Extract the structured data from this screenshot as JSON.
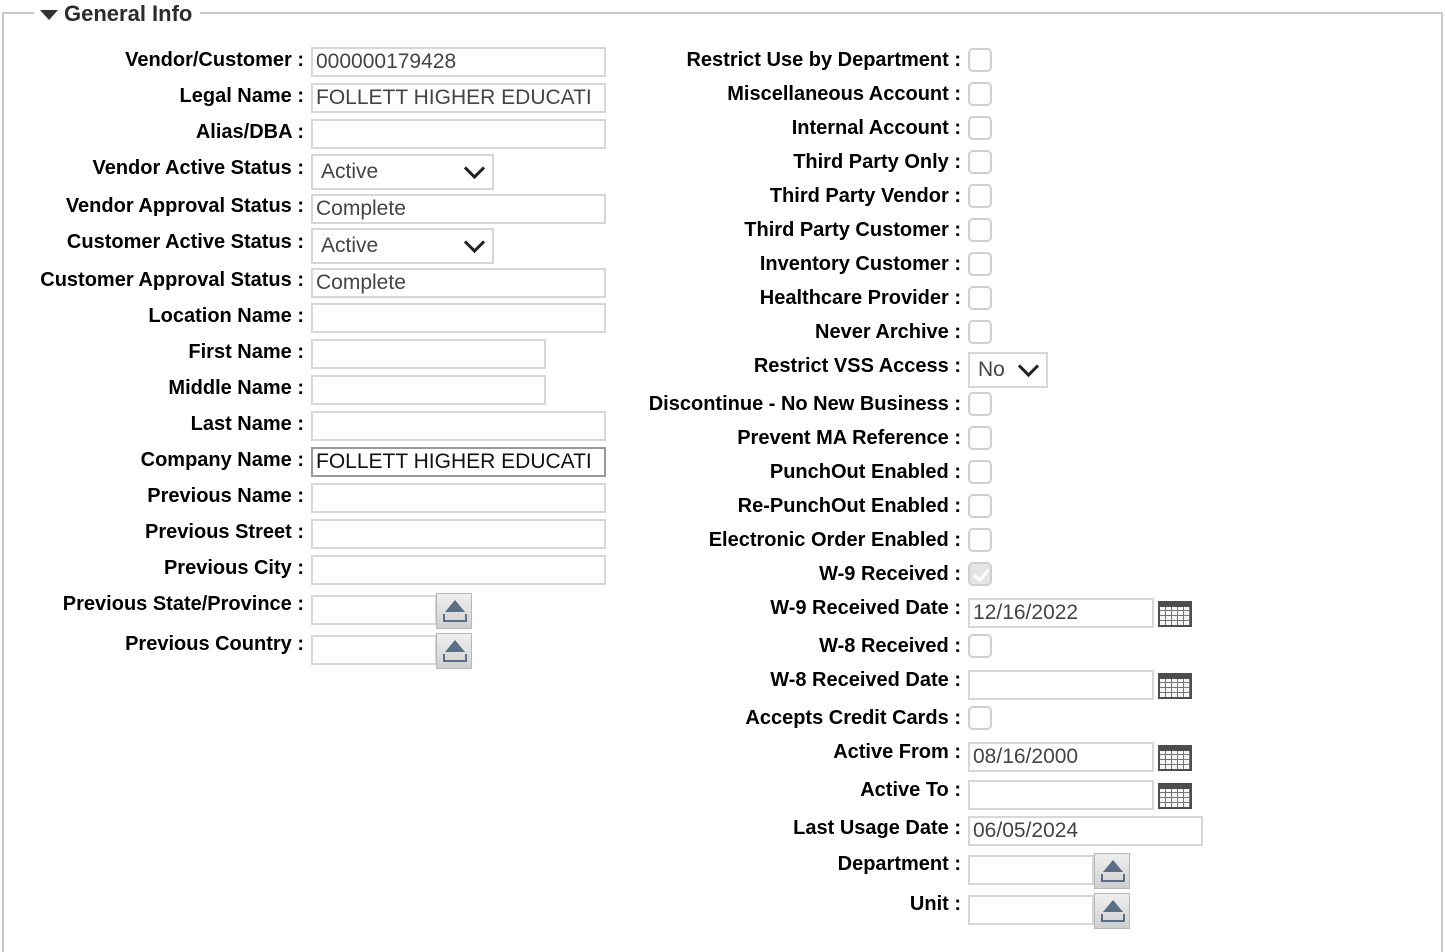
{
  "section": {
    "title": "General Info"
  },
  "left": {
    "vendor_customer": {
      "label": "Vendor/Customer :",
      "value": "000000179428"
    },
    "legal_name": {
      "label": "Legal Name :",
      "value": "FOLLETT HIGHER EDUCATI"
    },
    "alias_dba": {
      "label": "Alias/DBA :",
      "value": ""
    },
    "vendor_active_status": {
      "label": "Vendor Active Status :",
      "value": "Active"
    },
    "vendor_approval_status": {
      "label": "Vendor Approval Status :",
      "value": "Complete"
    },
    "customer_active_status": {
      "label": "Customer Active Status :",
      "value": "Active"
    },
    "customer_approval_status": {
      "label": "Customer Approval Status :",
      "value": "Complete"
    },
    "location_name": {
      "label": "Location Name :",
      "value": ""
    },
    "first_name": {
      "label": "First Name :",
      "value": ""
    },
    "middle_name": {
      "label": "Middle Name :",
      "value": ""
    },
    "last_name": {
      "label": "Last Name :",
      "value": ""
    },
    "company_name": {
      "label": "Company Name :",
      "value": "FOLLETT HIGHER EDUCATI"
    },
    "previous_name": {
      "label": "Previous Name :",
      "value": ""
    },
    "previous_street": {
      "label": "Previous Street :",
      "value": ""
    },
    "previous_city": {
      "label": "Previous City :",
      "value": ""
    },
    "previous_state": {
      "label": "Previous State/Province :",
      "value": ""
    },
    "previous_country": {
      "label": "Previous Country :",
      "value": ""
    }
  },
  "right": {
    "restrict_use_by_department": {
      "label": "Restrict Use by Department :",
      "checked": false
    },
    "miscellaneous_account": {
      "label": "Miscellaneous Account :",
      "checked": false
    },
    "internal_account": {
      "label": "Internal Account :",
      "checked": false
    },
    "third_party_only": {
      "label": "Third Party Only :",
      "checked": false
    },
    "third_party_vendor": {
      "label": "Third Party Vendor :",
      "checked": false
    },
    "third_party_customer": {
      "label": "Third Party Customer :",
      "checked": false
    },
    "inventory_customer": {
      "label": "Inventory Customer :",
      "checked": false
    },
    "healthcare_provider": {
      "label": "Healthcare Provider :",
      "checked": false
    },
    "never_archive": {
      "label": "Never Archive :",
      "checked": false
    },
    "restrict_vss_access": {
      "label": "Restrict VSS Access :",
      "value": "No"
    },
    "discontinue": {
      "label": "Discontinue - No New Business :",
      "checked": false
    },
    "prevent_ma_reference": {
      "label": "Prevent MA Reference :",
      "checked": false
    },
    "punchout_enabled": {
      "label": "PunchOut Enabled :",
      "checked": false
    },
    "repunchout_enabled": {
      "label": "Re-PunchOut Enabled :",
      "checked": false
    },
    "electronic_order_enabled": {
      "label": "Electronic Order Enabled :",
      "checked": false
    },
    "w9_received": {
      "label": "W-9 Received :",
      "checked": true
    },
    "w9_received_date": {
      "label": "W-9 Received Date :",
      "value": "12/16/2022"
    },
    "w8_received": {
      "label": "W-8 Received :",
      "checked": false
    },
    "w8_received_date": {
      "label": "W-8 Received Date :",
      "value": ""
    },
    "accepts_credit_cards": {
      "label": "Accepts Credit Cards :",
      "checked": false
    },
    "active_from": {
      "label": "Active From :",
      "value": "08/16/2000"
    },
    "active_to": {
      "label": "Active To :",
      "value": ""
    },
    "last_usage_date": {
      "label": "Last Usage Date :",
      "value": "06/05/2024"
    },
    "department": {
      "label": "Department :",
      "value": ""
    },
    "unit": {
      "label": "Unit :",
      "value": ""
    }
  }
}
